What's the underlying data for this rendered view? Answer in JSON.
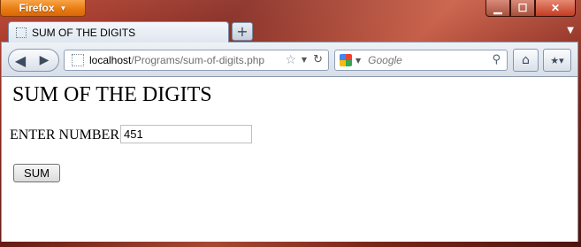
{
  "browser": {
    "app_button_label": "Firefox",
    "tab_title": "SUM OF THE DIGITS",
    "address": {
      "host": "localhost",
      "path": "/Programs/sum-of-digits.php"
    },
    "search_placeholder": "Google"
  },
  "page": {
    "heading": "SUM OF THE DIGITS",
    "number_label": "ENTER NUMBER:",
    "number_value": "451",
    "submit_label": "SUM"
  },
  "colors": {
    "firefox_button": "#e97c13",
    "window_frame": "#a4301f",
    "toolbar": "#dfe6ef"
  },
  "icons": [
    "firefox-caret-icon",
    "minimize-icon",
    "maximize-icon",
    "close-icon",
    "page-favicon",
    "new-tab-icon",
    "back-icon",
    "forward-icon",
    "bookmark-star-icon",
    "reload-icon",
    "google-icon",
    "search-icon",
    "home-icon",
    "bookmarks-menu-icon"
  ]
}
